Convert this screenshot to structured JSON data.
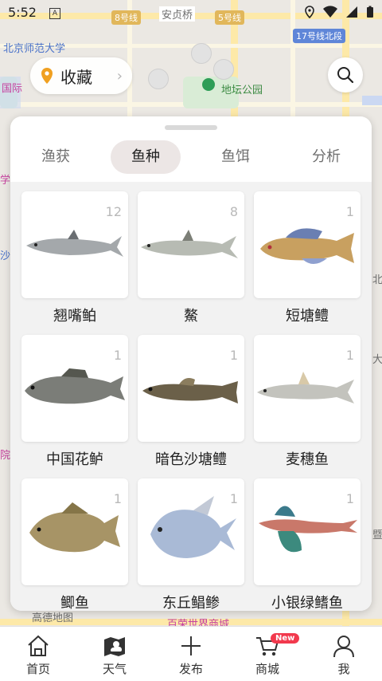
{
  "status_bar": {
    "time": "5:52",
    "notification_icon": "A"
  },
  "map": {
    "labels": [
      "北京师范大学",
      "安贞桥",
      "地坛公园",
      "百荣世界商城",
      "高德地图"
    ],
    "road_badges": [
      "8号线",
      "5号线",
      "17号线北段"
    ],
    "edge_labels": [
      "国际",
      "学",
      "沙",
      "院",
      "北",
      "大",
      "暨"
    ]
  },
  "favorites": {
    "label": "收藏",
    "icon": "location-pin-icon"
  },
  "tabs": [
    {
      "label": "渔获",
      "active": false
    },
    {
      "label": "鱼种",
      "active": true
    },
    {
      "label": "鱼饵",
      "active": false
    },
    {
      "label": "分析",
      "active": false
    }
  ],
  "fish": [
    {
      "name": "翘嘴鲌",
      "count": "12"
    },
    {
      "name": "鰲",
      "count": "8"
    },
    {
      "name": "短塘鳢",
      "count": "1"
    },
    {
      "name": "中国花鲈",
      "count": "1"
    },
    {
      "name": "暗色沙塘鳢",
      "count": "1"
    },
    {
      "name": "麦穗鱼",
      "count": "1"
    },
    {
      "name": "鲫鱼",
      "count": "1"
    },
    {
      "name": "东丘鲳鲹",
      "count": "1"
    },
    {
      "name": "小银绿鳍鱼",
      "count": "1"
    }
  ],
  "nav": [
    {
      "label": "首页",
      "icon": "home-icon"
    },
    {
      "label": "天气",
      "icon": "weather-icon"
    },
    {
      "label": "发布",
      "icon": "plus-icon"
    },
    {
      "label": "商城",
      "icon": "cart-icon",
      "badge": "New"
    },
    {
      "label": "我",
      "icon": "user-icon"
    }
  ],
  "colors": {
    "accent": "#f2394d",
    "active_tab_bg": "#ece6e5"
  }
}
